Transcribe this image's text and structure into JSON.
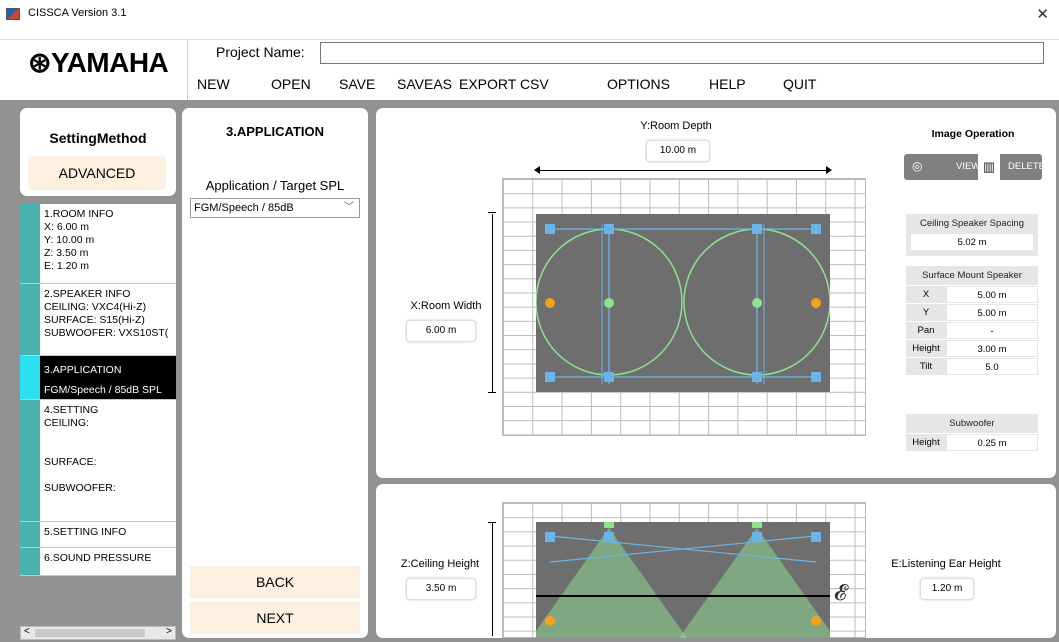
{
  "window": {
    "title": "CISSCA Version 3.1",
    "close_glyph": "✕"
  },
  "brand": {
    "logo": "⊛YAMAHA"
  },
  "project": {
    "label": "Project Name:",
    "value": ""
  },
  "menu": [
    "NEW",
    "OPEN",
    "SAVE",
    "SAVEAS",
    "EXPORT CSV",
    "OPTIONS",
    "HELP",
    "QUIT"
  ],
  "setting_method": {
    "title": "SettingMethod",
    "mode": "ADVANCED"
  },
  "steps": [
    {
      "lines": [
        "1.ROOM INFO",
        "X: 6.00 m",
        "Y: 10.00 m",
        "Z: 3.50 m",
        "E: 1.20 m"
      ]
    },
    {
      "lines": [
        "2.SPEAKER INFO",
        "CEILING: VXC4(Hi-Z)",
        "SURFACE: S15(Hi-Z)",
        "SUBWOOFER: VXS10ST("
      ]
    },
    {
      "lines": [
        "3.APPLICATION",
        "FGM/Speech / 85dB SPL"
      ]
    },
    {
      "lines": [
        "4.SETTING",
        "CEILING:",
        "",
        "",
        "SURFACE:",
        "",
        "SUBWOOFER:"
      ]
    },
    {
      "lines": [
        "5.SETTING INFO"
      ]
    },
    {
      "lines": [
        "6.SOUND PRESSURE"
      ]
    }
  ],
  "scroll": {
    "left": "<",
    "right": ">"
  },
  "application": {
    "title": "3.APPLICATION",
    "label": "Application / Target SPL",
    "selected": "FGM/Speech / 85dB",
    "back": "BACK",
    "next": "NEXT"
  },
  "plan": {
    "y_label": "Y:Room Depth",
    "y_value": "10.00 m",
    "x_label": "X:Room Width",
    "x_value": "6.00 m"
  },
  "image_operation": {
    "title": "Image Operation",
    "view": "VIEW",
    "delete": "DELETE",
    "eye_icon": "eye-icon",
    "trash_icon": "trash-icon"
  },
  "ceiling_spacing": {
    "title": "Ceiling Speaker Spacing",
    "value": "5.02 m"
  },
  "surface_mount": {
    "title": "Surface Mount Speaker",
    "rows": [
      {
        "k": "X",
        "v": "5.00 m"
      },
      {
        "k": "Y",
        "v": "5.00 m"
      },
      {
        "k": "Pan",
        "v": "-"
      },
      {
        "k": "Height",
        "v": "3.00 m"
      },
      {
        "k": "Tilt",
        "v": "5.0"
      }
    ]
  },
  "subwoofer": {
    "title": "Subwoofer",
    "k": "Height",
    "v": "0.25 m"
  },
  "elevation": {
    "z_label": "Z:Ceiling Height",
    "z_value": "3.50 m",
    "e_label": "E:Listening Ear Height",
    "e_value": "1.20 m",
    "ear_icon": "ear-icon"
  },
  "colors": {
    "accent_teal": "#4ab3b0",
    "active_cyan": "#2ae0f0",
    "button_bg": "#fdf0e0",
    "speaker_blue": "#6ab4e8",
    "coverage_green": "#8fe08f",
    "sub_orange": "#f5a21b"
  }
}
